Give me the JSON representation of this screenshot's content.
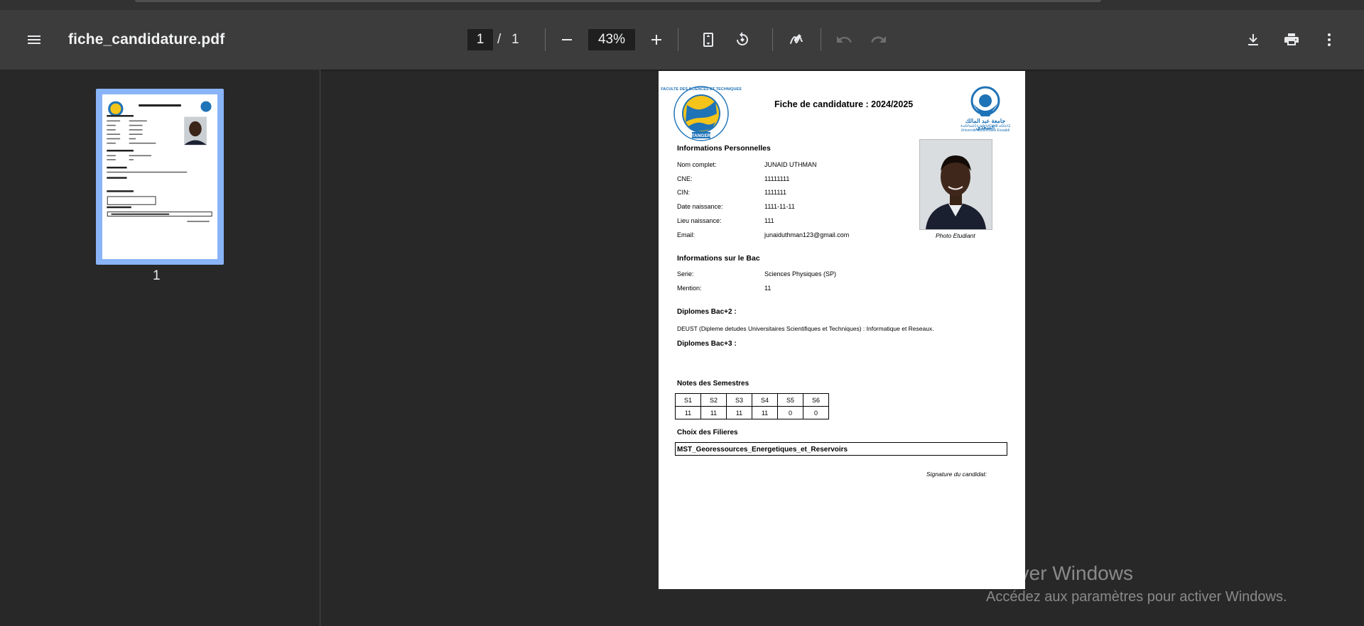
{
  "toolbar": {
    "title": "fiche_candidature.pdf",
    "page_current": "1",
    "page_separator": "/",
    "page_total": "1",
    "zoom": "43%"
  },
  "sidebar": {
    "thumbnail_label": "1"
  },
  "document": {
    "title": "Fiche de candidature : 2024/2025",
    "left_logo_text_top": "FACULTE DES SCIENCES ET TECHNIQUES",
    "left_logo_text_bottom": "TANGER",
    "right_logo_text_ar": "جامعة عبد المالك السعدي",
    "right_logo_text_ar2": "ⵜⴰⵙⴷⴰⵡⵉⵜ ⵄⴱⴷⵍⵎⴰⵍⴽ ⴰⵙⵄⴷⵉ",
    "right_logo_text_fr": "Université Abdelmalek Essaâdi",
    "personal": {
      "heading": "Informations Personnelles",
      "rows": [
        {
          "label": "Nom complet:",
          "value": "JUNAID UTHMAN"
        },
        {
          "label": "CNE:",
          "value": "11111111"
        },
        {
          "label": "CIN:",
          "value": "1111111"
        },
        {
          "label": "Date naissance:",
          "value": "1111-11-11"
        },
        {
          "label": "Lieu naissance:",
          "value": "111"
        },
        {
          "label": "Email:",
          "value": "junaiduthman123@gmail.com"
        }
      ],
      "photo_caption": "Photo Etudiant"
    },
    "bac": {
      "heading": "Informations sur le Bac",
      "rows": [
        {
          "label": "Serie:",
          "value": "Sciences Physiques (SP)"
        },
        {
          "label": "Mention:",
          "value": "11"
        }
      ]
    },
    "bac2": {
      "heading": "Diplomes Bac+2 :",
      "text": "DEUST (Dipleme detudes Universitaires Scientifiques et Techniques) : Informatique et Reseaux."
    },
    "bac3": {
      "heading": "Diplomes Bac+3 :"
    },
    "notes": {
      "heading": "Notes des Semestres",
      "headers": [
        "S1",
        "S2",
        "S3",
        "S4",
        "S5",
        "S6"
      ],
      "values": [
        "11",
        "11",
        "11",
        "11",
        "0",
        "0"
      ]
    },
    "filieres": {
      "heading": "Choix des Filieres",
      "value": "MST_Georessources_Energetiques_et_Reservoirs"
    },
    "signature": "Signature du candidat:"
  },
  "watermark": {
    "title": "Activer Windows",
    "subtitle": "Accédez aux paramètres pour activer Windows."
  },
  "colors": {
    "toolbar_bg": "#3c3c3c",
    "viewer_bg": "#282828",
    "thumb_selected": "#8ab4f8",
    "logo_yellow": "#f4c41a",
    "logo_blue": "#1f73b7"
  },
  "icons": [
    "menu-icon",
    "zoom-out-icon",
    "zoom-in-icon",
    "fit-page-icon",
    "rotate-icon",
    "annotate-icon",
    "undo-icon",
    "redo-icon",
    "download-icon",
    "print-icon",
    "more-vert-icon"
  ]
}
